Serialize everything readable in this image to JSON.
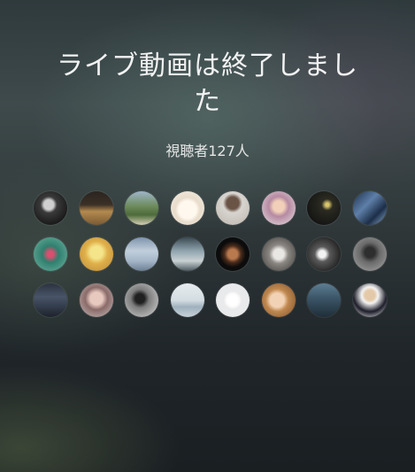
{
  "ended_message": "ライブ動画は終了しました",
  "viewer_count_text": "視聴者127人",
  "viewers": [
    {
      "icon": "viewer-avatar-1"
    },
    {
      "icon": "viewer-avatar-2"
    },
    {
      "icon": "viewer-avatar-3"
    },
    {
      "icon": "viewer-avatar-4"
    },
    {
      "icon": "viewer-avatar-5"
    },
    {
      "icon": "viewer-avatar-6"
    },
    {
      "icon": "viewer-avatar-7"
    },
    {
      "icon": "viewer-avatar-8"
    },
    {
      "icon": "viewer-avatar-9"
    },
    {
      "icon": "viewer-avatar-10"
    },
    {
      "icon": "viewer-avatar-11"
    },
    {
      "icon": "viewer-avatar-12"
    },
    {
      "icon": "viewer-avatar-13"
    },
    {
      "icon": "viewer-avatar-14"
    },
    {
      "icon": "viewer-avatar-15"
    },
    {
      "icon": "viewer-avatar-16"
    },
    {
      "icon": "viewer-avatar-17"
    },
    {
      "icon": "viewer-avatar-18"
    },
    {
      "icon": "viewer-avatar-19"
    },
    {
      "icon": "viewer-avatar-20"
    },
    {
      "icon": "viewer-avatar-21"
    },
    {
      "icon": "viewer-avatar-22"
    },
    {
      "icon": "viewer-avatar-23"
    },
    {
      "icon": "viewer-avatar-24"
    }
  ]
}
